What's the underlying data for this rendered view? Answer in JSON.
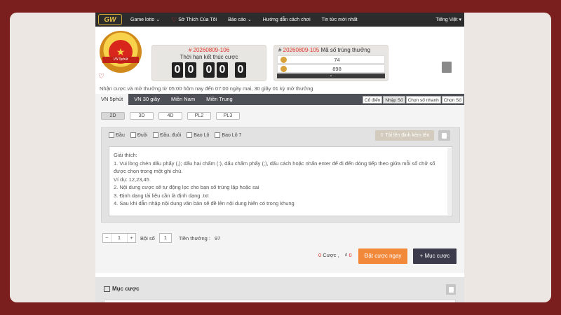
{
  "nav": {
    "logo": "GW",
    "items": [
      "Game lotto",
      "Sở Thích Của Tôi",
      "Báo cáo",
      "Hướng dẫn cách chơi",
      "Tin tức mới nhất"
    ],
    "language": "Tiếng Việt"
  },
  "header": {
    "badge_text": "VN 5phút",
    "round_prefix": "#",
    "round_number": "20260809-106",
    "countdown_label": "Thời hạn kết thúc cược",
    "countdown_digits": [
      "0",
      "0",
      "0",
      "0",
      "0"
    ],
    "result_round": "20260809-105",
    "result_label": "Mã số trúng thưởng",
    "results": [
      "74",
      "898"
    ],
    "notice": "Nhận cược và mở thưởng từ 05:00 hôm nay đến 07:00 ngày mai,    30 giây 01 kỳ mở thưởng"
  },
  "tabs": [
    "VN 5phút",
    "VN 30 giây",
    "Miền Nam",
    "Miền Trung"
  ],
  "modes": [
    "Cổ điển",
    "Nhập Số",
    "Chọn số nhanh",
    "Chọn Số"
  ],
  "digit_types": [
    "2D",
    "3D",
    "4D",
    "PL2",
    "PL3"
  ],
  "options": [
    "Đầu",
    "Đuôi",
    "Đầu, đuôi",
    "Bao Lô",
    "Bao Lô 7"
  ],
  "upload_label": "⇧ Tải lên định kèm tên",
  "instructions": [
    "Giải thích:",
    "1. Vui lòng chèn dấu phẩy (,); dấu hai chấm (:), dấu chấm phẩy (;), dấu cách hoặc nhấn enter để đi đến dòng tiếp theo giữa mỗi số chữ số",
    "được chọn trong một ghi chú.",
    "Ví dụ: 12,23,45",
    "2. Nội dung cược sẽ tự động lọc cho bạn số trùng lặp hoặc sai",
    "3. Định dạng tài liệu cần là định dạng .txt",
    "4. Sau khi dẫn nhập nội dung văn bản sẽ đề lên nội dung hiển có trong khung"
  ],
  "stepper": {
    "value": "1",
    "minus": "−",
    "plus": "+"
  },
  "multiplier_label": "Bội số",
  "multiplier_value": "1",
  "prize": {
    "label": "Tiền thưởng :",
    "value": "97"
  },
  "summary": {
    "bets": "0",
    "bets_label": "Cược ,",
    "currency": "₫",
    "total": "0"
  },
  "bet_now_label": "Đặt cược ngay",
  "add_bet_label": "+ Mục cược",
  "bet_section_title": "Mục cược"
}
